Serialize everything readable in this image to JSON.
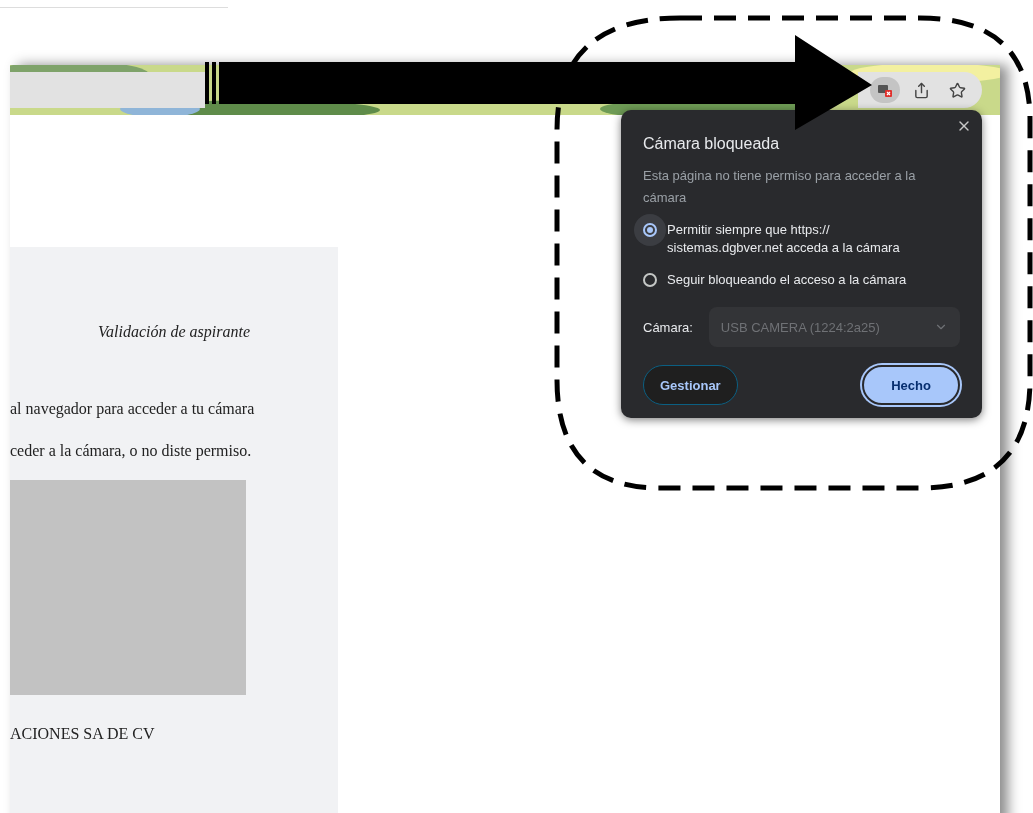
{
  "popup": {
    "title": "Cámara bloqueada",
    "description": "Esta página no tiene permiso para acceder a la cámara",
    "options": [
      {
        "label": "Permitir siempre que https:// sistemas.dgbver.net acceda a la cámara",
        "selected": true
      },
      {
        "label": "Seguir bloqueando el acceso a la cámara",
        "selected": false
      }
    ],
    "camera": {
      "label": "Cámara:",
      "value": "USB CAMERA (1224:2a25)",
      "disabled": true
    },
    "buttons": [
      {
        "label": "Gestionar",
        "kind": "secondary"
      },
      {
        "label": "Hecho",
        "kind": "primary"
      }
    ]
  },
  "page": {
    "heading": "Validación de aspirante",
    "lines": [
      "al navegador para acceder a tu cámara",
      "ceder a la cámara, o no diste permiso."
    ],
    "company": "ACIONES SA DE CV"
  }
}
